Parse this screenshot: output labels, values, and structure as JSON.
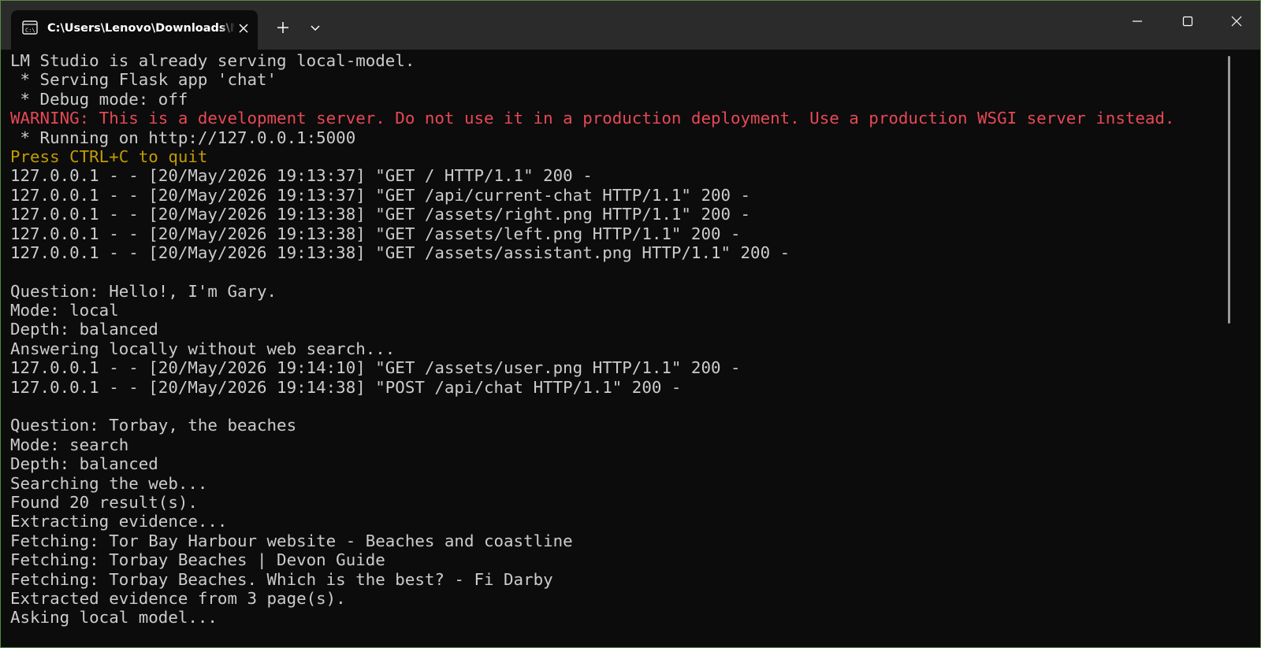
{
  "window": {
    "tab_title": "C:\\Users\\Lenovo\\Downloads\\MyChat",
    "colors": {
      "frame": "#4f7a3c",
      "titlebar": "#2b2b2b",
      "background": "#0c0c0c",
      "text": "#cccccc",
      "warning": "#e74856",
      "highlight": "#c19c00"
    },
    "icons": {
      "tab_icon": "terminal-icon",
      "tab_close": "close-icon",
      "new_tab": "plus-icon",
      "dropdown": "chevron-down-icon",
      "minimize": "minimize-icon",
      "maximize": "maximize-icon",
      "close": "close-icon"
    }
  },
  "console": {
    "lines": [
      {
        "text": "LM Studio is already serving local-model.",
        "style": "normal"
      },
      {
        "text": " * Serving Flask app 'chat'",
        "style": "normal"
      },
      {
        "text": " * Debug mode: off",
        "style": "normal"
      },
      {
        "text": "WARNING: This is a development server. Do not use it in a production deployment. Use a production WSGI server instead.",
        "style": "warn"
      },
      {
        "text": " * Running on http://127.0.0.1:5000",
        "style": "normal"
      },
      {
        "text": "Press CTRL+C to quit",
        "style": "yellow"
      },
      {
        "text": "127.0.0.1 - - [20/May/2026 19:13:37] \"GET / HTTP/1.1\" 200 -",
        "style": "normal"
      },
      {
        "text": "127.0.0.1 - - [20/May/2026 19:13:37] \"GET /api/current-chat HTTP/1.1\" 200 -",
        "style": "normal"
      },
      {
        "text": "127.0.0.1 - - [20/May/2026 19:13:38] \"GET /assets/right.png HTTP/1.1\" 200 -",
        "style": "normal"
      },
      {
        "text": "127.0.0.1 - - [20/May/2026 19:13:38] \"GET /assets/left.png HTTP/1.1\" 200 -",
        "style": "normal"
      },
      {
        "text": "127.0.0.1 - - [20/May/2026 19:13:38] \"GET /assets/assistant.png HTTP/1.1\" 200 -",
        "style": "normal"
      },
      {
        "text": "",
        "style": "normal"
      },
      {
        "text": "Question: Hello!, I'm Gary.",
        "style": "normal"
      },
      {
        "text": "Mode: local",
        "style": "normal"
      },
      {
        "text": "Depth: balanced",
        "style": "normal"
      },
      {
        "text": "Answering locally without web search...",
        "style": "normal"
      },
      {
        "text": "127.0.0.1 - - [20/May/2026 19:14:10] \"GET /assets/user.png HTTP/1.1\" 200 -",
        "style": "normal"
      },
      {
        "text": "127.0.0.1 - - [20/May/2026 19:14:38] \"POST /api/chat HTTP/1.1\" 200 -",
        "style": "normal"
      },
      {
        "text": "",
        "style": "normal"
      },
      {
        "text": "Question: Torbay, the beaches",
        "style": "normal"
      },
      {
        "text": "Mode: search",
        "style": "normal"
      },
      {
        "text": "Depth: balanced",
        "style": "normal"
      },
      {
        "text": "Searching the web...",
        "style": "normal"
      },
      {
        "text": "Found 20 result(s).",
        "style": "normal"
      },
      {
        "text": "Extracting evidence...",
        "style": "normal"
      },
      {
        "text": "Fetching: Tor Bay Harbour website - Beaches and coastline",
        "style": "normal"
      },
      {
        "text": "Fetching: Torbay Beaches | Devon Guide",
        "style": "normal"
      },
      {
        "text": "Fetching: Torbay Beaches. Which is the best? - Fi Darby",
        "style": "normal"
      },
      {
        "text": "Extracted evidence from 3 page(s).",
        "style": "normal"
      },
      {
        "text": "Asking local model...",
        "style": "normal"
      }
    ]
  }
}
